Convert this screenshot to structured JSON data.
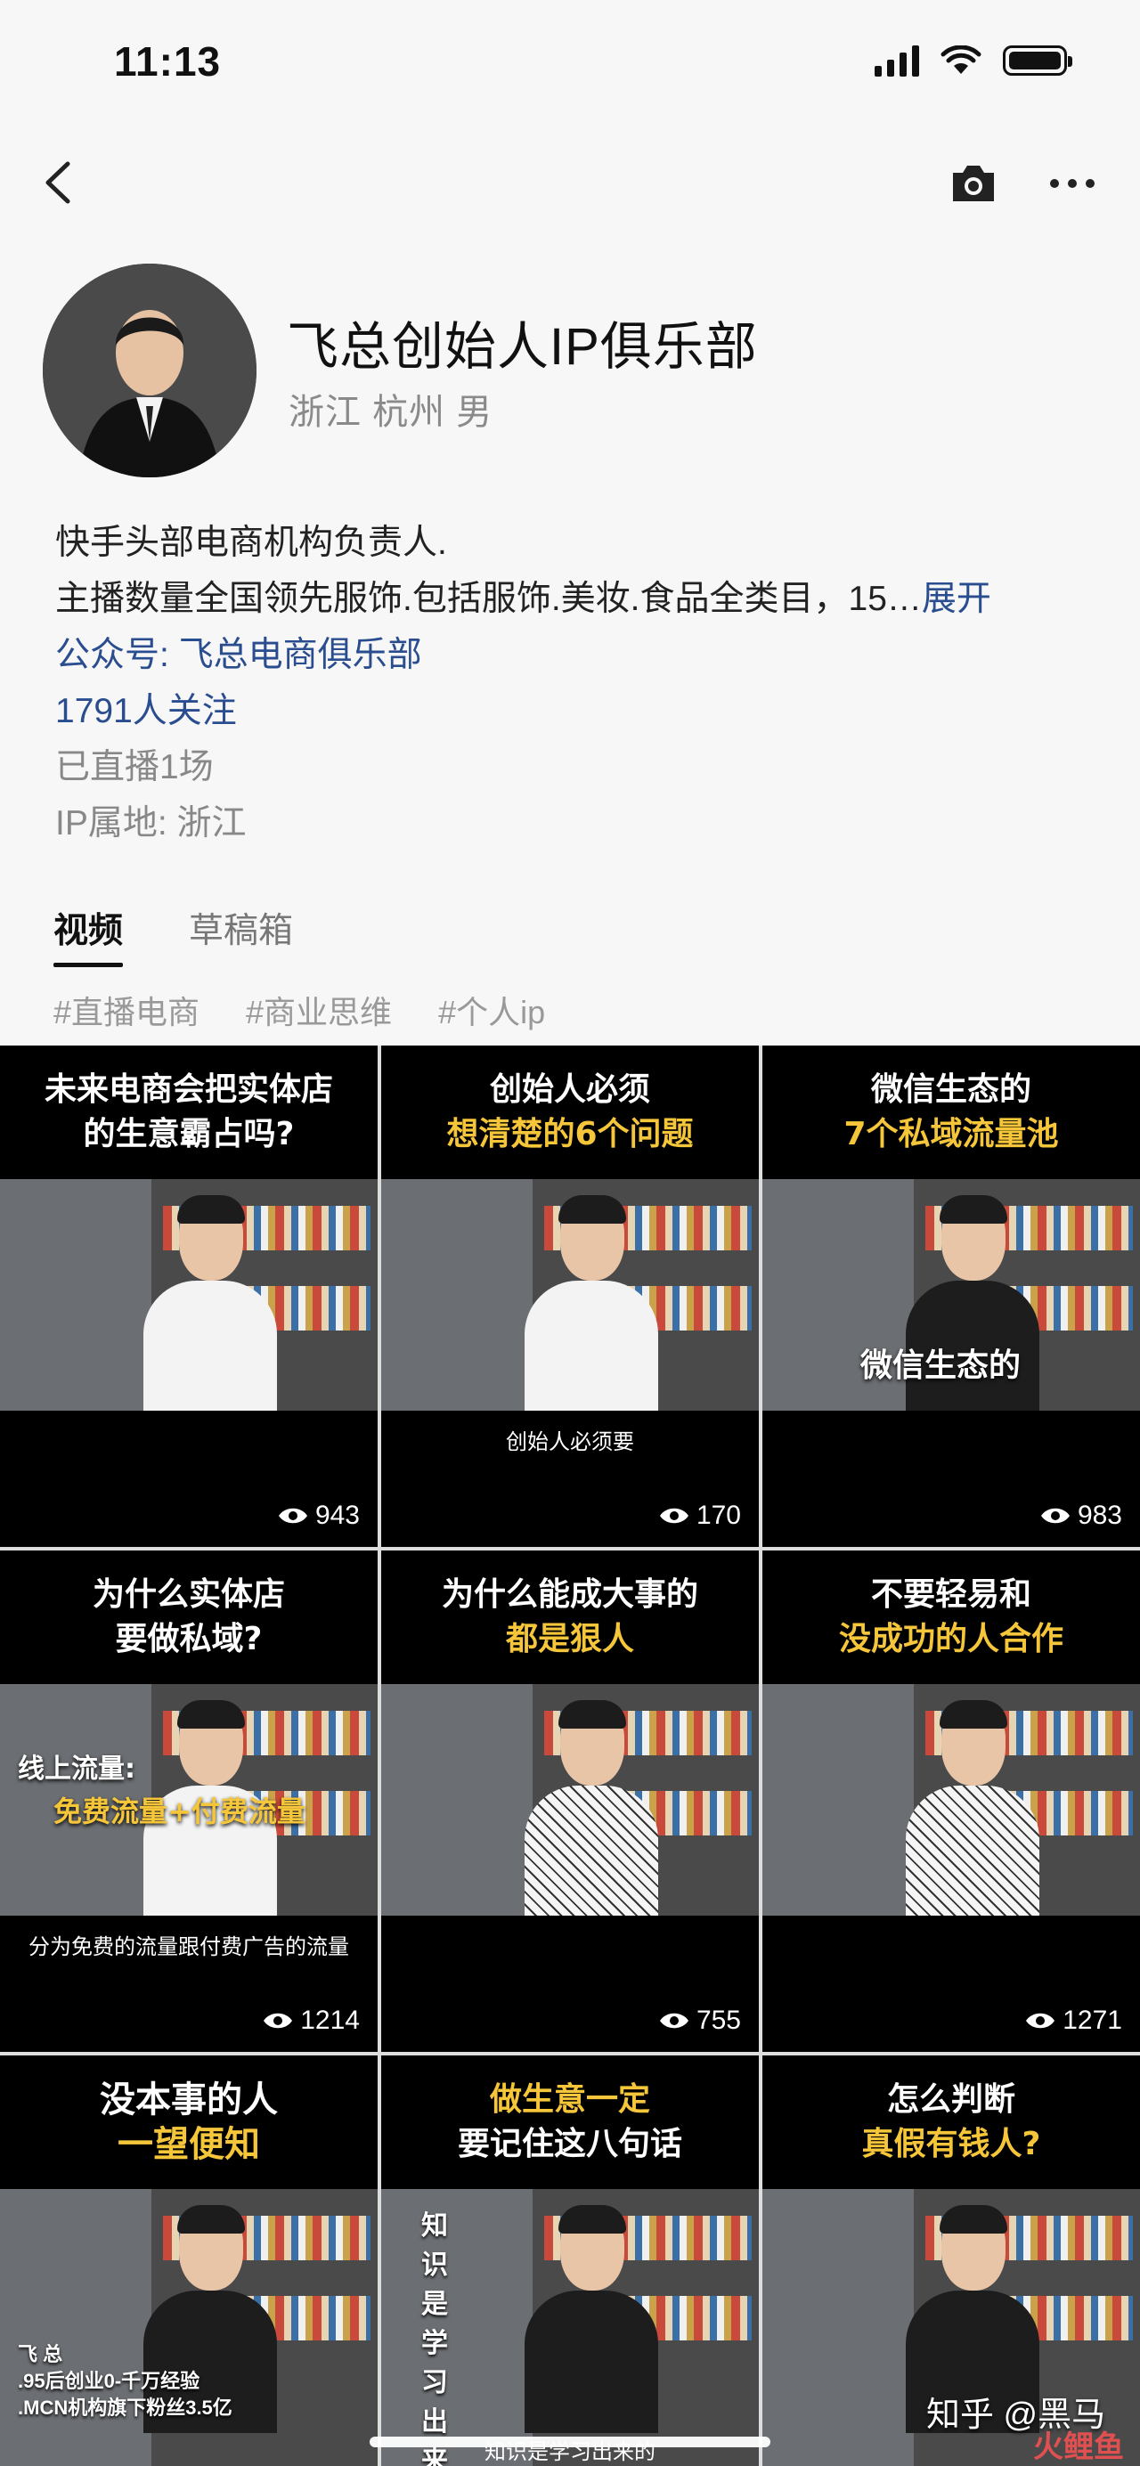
{
  "status": {
    "time": "11:13"
  },
  "profile": {
    "name": "飞总创始人IP俱乐部",
    "meta": "浙江 杭州  男",
    "bio_line1": "快手头部电商机构负责人.",
    "bio_line2": "主播数量全国领先服饰.包括服饰.美妆.食品全类目，15…",
    "expand": "展开",
    "official_account": "公众号: 飞总电商俱乐部",
    "followers": "1791人关注",
    "live_count": "已直播1场",
    "ip_location": "IP属地: 浙江"
  },
  "tabs": [
    {
      "label": "视频",
      "active": true
    },
    {
      "label": "草稿箱",
      "active": false
    }
  ],
  "hashtags": [
    "#直播电商",
    "#商业思维",
    "#个人ip"
  ],
  "videos": [
    {
      "title1": "未来电商会把实体店",
      "title2": "的生意霸占吗?",
      "subtitle": "",
      "views": "943"
    },
    {
      "title1": "创始人必须",
      "title2": "想清楚的6个问题",
      "subtitle": "创始人必须要",
      "views": "170"
    },
    {
      "title1": "微信生态的",
      "title2": "7个私域流量池",
      "subtitle": "",
      "overlay": "微信生态的",
      "views": "983"
    },
    {
      "title1": "为什么实体店",
      "title2": "要做私域?",
      "subtitle": "分为免费的流量跟付费广告的流量",
      "overlay": "线上流量:",
      "overlay2": "免费流量+付费流量",
      "views": "1214"
    },
    {
      "title1": "为什么能成大事的",
      "title2": "都是狠人",
      "subtitle": "",
      "views": "755"
    },
    {
      "title1": "不要轻易和",
      "title2": "没成功的人合作",
      "subtitle": "",
      "views": "1271"
    },
    {
      "title1": "没本事的人",
      "title2": "一望便知",
      "subtitle": "",
      "overlay": "飞 总",
      "overlay2": ".95后创业0-千万经验",
      "overlay3": ".MCN机构旗下粉丝3.5亿",
      "views": ""
    },
    {
      "title1": "做生意一定",
      "title2": "要记住这八句话",
      "subtitle": "知识是学习出来的",
      "vertical": "知识是学习出来的",
      "views": ""
    },
    {
      "title1": "怎么判断",
      "title2": "真假有钱人?",
      "subtitle": "",
      "views": ""
    }
  ],
  "watermark": "知乎 @黑马",
  "watermark2": "火鲤鱼"
}
